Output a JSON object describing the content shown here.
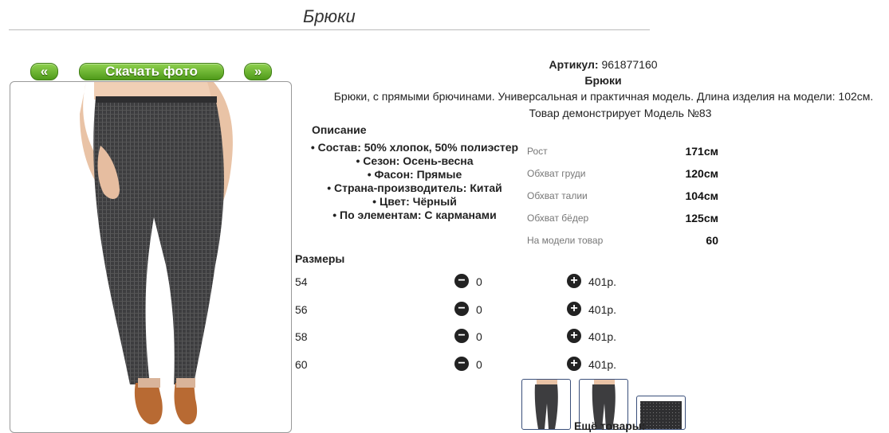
{
  "page": {
    "title": "Брюки"
  },
  "gallery": {
    "prev_label": "«",
    "download_label": "Скачать фото",
    "next_label": "»"
  },
  "product": {
    "article_label": "Артикул:",
    "article_value": "961877160",
    "name": "Брюки",
    "description": "Брюки, с прямыми брючинами. Универсальная и практичная модель. Длина изделия на модели: 102см.",
    "model_note": "Товар демонстрирует Модель №83"
  },
  "details": {
    "title": "Описание",
    "items": [
      "• Состав: 50% хлопок, 50% полиэстер",
      "• Сезон: Осень-весна",
      "• Фасон: Прямые",
      "• Страна-производитель: Китай",
      "• Цвет: Чёрный",
      "• По элементам: С карманами"
    ]
  },
  "measurements": [
    {
      "label": "Рост",
      "value": "171см"
    },
    {
      "label": "Обхват груди",
      "value": "120см"
    },
    {
      "label": "Обхват талии",
      "value": "104см"
    },
    {
      "label": "Обхват бёдер",
      "value": "125см"
    },
    {
      "label": "На модели товар",
      "value": "60"
    }
  ],
  "sizes": {
    "title": "Размеры",
    "rows": [
      {
        "size": "54",
        "qty": "0",
        "price": "401р."
      },
      {
        "size": "56",
        "qty": "0",
        "price": "401р."
      },
      {
        "size": "58",
        "qty": "0",
        "price": "401р."
      },
      {
        "size": "60",
        "qty": "0",
        "price": "401р."
      }
    ],
    "minus_icon": "−",
    "plus_icon": "+"
  },
  "more": {
    "label": "Ещё товары:"
  },
  "colors": {
    "accent": "#4f9a1a",
    "text": "#222222"
  }
}
